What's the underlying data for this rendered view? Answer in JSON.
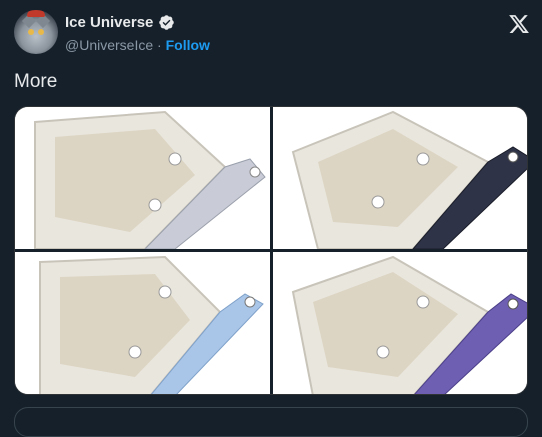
{
  "author": {
    "display_name": "Ice Universe",
    "handle": "@UniverseIce",
    "separator": "·",
    "follow_label": "Follow"
  },
  "tweet": {
    "text": "More"
  },
  "media": {
    "photos": [
      {
        "tray_color": "#c9ccd6",
        "accent": "lavender-grey"
      },
      {
        "tray_color": "#2e3347",
        "accent": "dark-navy"
      },
      {
        "tray_color": "#a9c6e8",
        "accent": "light-blue"
      },
      {
        "tray_color": "#6f5fb3",
        "accent": "violet"
      }
    ]
  },
  "icons": {
    "verified": "verified-badge-icon",
    "x_logo": "x-logo-icon"
  },
  "colors": {
    "background": "#15202b",
    "link": "#1d9bf0",
    "secondary_text": "#8b98a5"
  }
}
